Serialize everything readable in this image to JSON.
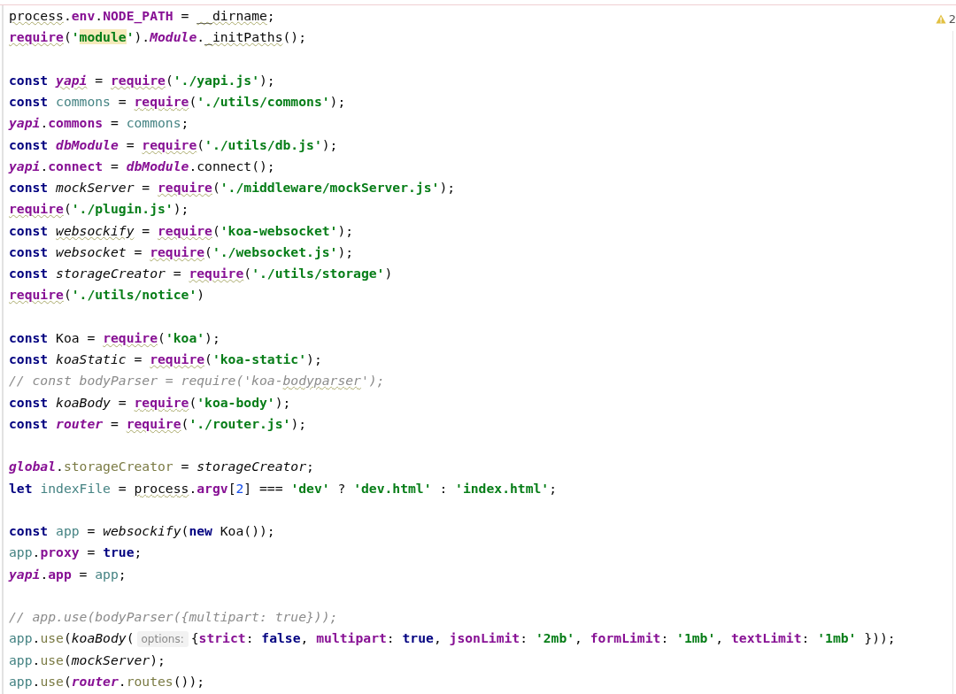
{
  "editor": {
    "warnings": "2",
    "blocks": [
      {
        "lines": [
          {
            "tokens": [
              {
                "kind": "plain",
                "text": "process",
                "squiggle": true
              },
              {
                "kind": "plain",
                "text": "."
              },
              {
                "kind": "prop",
                "text": "env"
              },
              {
                "kind": "plain",
                "text": "."
              },
              {
                "kind": "prop",
                "text": "NODE_PATH"
              },
              {
                "kind": "plain",
                "text": " = "
              },
              {
                "kind": "plain",
                "text": "__dirname",
                "squiggle": true
              },
              {
                "kind": "plain",
                "text": ";"
              }
            ]
          },
          {
            "tokens": [
              {
                "kind": "prop",
                "text": "require",
                "squiggle": true
              },
              {
                "kind": "plain",
                "text": "("
              },
              {
                "kind": "str",
                "text": "'"
              },
              {
                "kind": "str",
                "text": "module",
                "highlighted": true
              },
              {
                "kind": "str",
                "text": "'"
              },
              {
                "kind": "plain",
                "text": ")."
              },
              {
                "kind": "gvar",
                "text": "Module"
              },
              {
                "kind": "plain",
                "text": "."
              },
              {
                "kind": "plain",
                "text": "_initPaths",
                "squiggle": true
              },
              {
                "kind": "plain",
                "text": "();"
              }
            ]
          }
        ]
      },
      {
        "lines": [
          {
            "tokens": [
              {
                "kind": "kw",
                "text": "const "
              },
              {
                "kind": "gvar",
                "text": "yapi",
                "squiggle": true
              },
              {
                "kind": "plain",
                "text": " = "
              },
              {
                "kind": "prop",
                "text": "require",
                "squiggle": true
              },
              {
                "kind": "plain",
                "text": "("
              },
              {
                "kind": "str",
                "text": "'./yapi.js'"
              },
              {
                "kind": "plain",
                "text": ");"
              }
            ]
          },
          {
            "tokens": [
              {
                "kind": "kw",
                "text": "const "
              },
              {
                "kind": "lvar",
                "text": "commons"
              },
              {
                "kind": "plain",
                "text": " = "
              },
              {
                "kind": "prop",
                "text": "require",
                "squiggle": true
              },
              {
                "kind": "plain",
                "text": "("
              },
              {
                "kind": "str",
                "text": "'./utils/commons'"
              },
              {
                "kind": "plain",
                "text": ");"
              }
            ]
          },
          {
            "tokens": [
              {
                "kind": "gvar",
                "text": "yapi"
              },
              {
                "kind": "plain",
                "text": "."
              },
              {
                "kind": "prop",
                "text": "commons"
              },
              {
                "kind": "plain",
                "text": " = "
              },
              {
                "kind": "lvar",
                "text": "commons"
              },
              {
                "kind": "plain",
                "text": ";"
              }
            ]
          },
          {
            "tokens": [
              {
                "kind": "kw",
                "text": "const "
              },
              {
                "kind": "gvar",
                "text": "dbModule"
              },
              {
                "kind": "plain",
                "text": " = "
              },
              {
                "kind": "prop",
                "text": "require",
                "squiggle": true
              },
              {
                "kind": "plain",
                "text": "("
              },
              {
                "kind": "str",
                "text": "'./utils/db.js'"
              },
              {
                "kind": "plain",
                "text": ");"
              }
            ]
          },
          {
            "tokens": [
              {
                "kind": "gvar",
                "text": "yapi"
              },
              {
                "kind": "plain",
                "text": "."
              },
              {
                "kind": "prop",
                "text": "connect"
              },
              {
                "kind": "plain",
                "text": " = "
              },
              {
                "kind": "gvar",
                "text": "dbModule"
              },
              {
                "kind": "plain",
                "text": ".connect();"
              }
            ]
          },
          {
            "tokens": [
              {
                "kind": "kw",
                "text": "const "
              },
              {
                "kind": "fn",
                "text": "mockServer"
              },
              {
                "kind": "plain",
                "text": " = "
              },
              {
                "kind": "prop",
                "text": "require",
                "squiggle": true
              },
              {
                "kind": "plain",
                "text": "("
              },
              {
                "kind": "str",
                "text": "'./middleware/mockServer.js'"
              },
              {
                "kind": "plain",
                "text": ");"
              }
            ]
          },
          {
            "tokens": [
              {
                "kind": "prop",
                "text": "require",
                "squiggle": true
              },
              {
                "kind": "plain",
                "text": "("
              },
              {
                "kind": "str",
                "text": "'./plugin.js'"
              },
              {
                "kind": "plain",
                "text": ");"
              }
            ]
          },
          {
            "tokens": [
              {
                "kind": "kw",
                "text": "const "
              },
              {
                "kind": "fn",
                "text": "websockify",
                "squiggle": true
              },
              {
                "kind": "plain",
                "text": " = "
              },
              {
                "kind": "prop",
                "text": "require",
                "squiggle": true
              },
              {
                "kind": "plain",
                "text": "("
              },
              {
                "kind": "str",
                "text": "'koa-websocket'"
              },
              {
                "kind": "plain",
                "text": ");"
              }
            ]
          },
          {
            "tokens": [
              {
                "kind": "kw",
                "text": "const "
              },
              {
                "kind": "fn",
                "text": "websocket"
              },
              {
                "kind": "plain",
                "text": " = "
              },
              {
                "kind": "prop",
                "text": "require",
                "squiggle": true
              },
              {
                "kind": "plain",
                "text": "("
              },
              {
                "kind": "str",
                "text": "'./websocket.js'"
              },
              {
                "kind": "plain",
                "text": ");"
              }
            ]
          },
          {
            "tokens": [
              {
                "kind": "kw",
                "text": "const "
              },
              {
                "kind": "fn",
                "text": "storageCreator"
              },
              {
                "kind": "plain",
                "text": " = "
              },
              {
                "kind": "prop",
                "text": "require",
                "squiggle": true
              },
              {
                "kind": "plain",
                "text": "("
              },
              {
                "kind": "str",
                "text": "'./utils/storage'"
              },
              {
                "kind": "plain",
                "text": ")"
              }
            ]
          },
          {
            "tokens": [
              {
                "kind": "prop",
                "text": "require",
                "squiggle": true
              },
              {
                "kind": "plain",
                "text": "("
              },
              {
                "kind": "str",
                "text": "'./utils/notice'"
              },
              {
                "kind": "plain",
                "text": ")"
              }
            ]
          }
        ]
      },
      {
        "lines": [
          {
            "tokens": [
              {
                "kind": "kw",
                "text": "const "
              },
              {
                "kind": "plain",
                "text": "Koa = "
              },
              {
                "kind": "prop",
                "text": "require",
                "squiggle": true
              },
              {
                "kind": "plain",
                "text": "("
              },
              {
                "kind": "str",
                "text": "'koa'"
              },
              {
                "kind": "plain",
                "text": ");"
              }
            ]
          },
          {
            "tokens": [
              {
                "kind": "kw",
                "text": "const "
              },
              {
                "kind": "fn",
                "text": "koaStatic"
              },
              {
                "kind": "plain",
                "text": " = "
              },
              {
                "kind": "prop",
                "text": "require",
                "squiggle": true
              },
              {
                "kind": "plain",
                "text": "("
              },
              {
                "kind": "str",
                "text": "'koa-static'"
              },
              {
                "kind": "plain",
                "text": ");"
              }
            ]
          },
          {
            "tokens": [
              {
                "kind": "comment",
                "text": "// const bodyParser = require('koa-"
              },
              {
                "kind": "comment",
                "text": "bodyparser",
                "squiggle": true
              },
              {
                "kind": "comment",
                "text": "');"
              }
            ]
          },
          {
            "tokens": [
              {
                "kind": "kw",
                "text": "const "
              },
              {
                "kind": "fn",
                "text": "koaBody"
              },
              {
                "kind": "plain",
                "text": " = "
              },
              {
                "kind": "prop",
                "text": "require",
                "squiggle": true
              },
              {
                "kind": "plain",
                "text": "("
              },
              {
                "kind": "str",
                "text": "'koa-body'"
              },
              {
                "kind": "plain",
                "text": ");"
              }
            ]
          },
          {
            "tokens": [
              {
                "kind": "kw",
                "text": "const "
              },
              {
                "kind": "gvar",
                "text": "router"
              },
              {
                "kind": "plain",
                "text": " = "
              },
              {
                "kind": "prop",
                "text": "require",
                "squiggle": true
              },
              {
                "kind": "plain",
                "text": "("
              },
              {
                "kind": "str",
                "text": "'./router.js'"
              },
              {
                "kind": "plain",
                "text": ");"
              }
            ]
          }
        ]
      },
      {
        "lines": [
          {
            "tokens": [
              {
                "kind": "gvar",
                "text": "global"
              },
              {
                "kind": "plain",
                "text": "."
              },
              {
                "kind": "member",
                "text": "storageCreator"
              },
              {
                "kind": "plain",
                "text": " = "
              },
              {
                "kind": "fn",
                "text": "storageCreator"
              },
              {
                "kind": "plain",
                "text": ";"
              }
            ]
          },
          {
            "tokens": [
              {
                "kind": "kw",
                "text": "let "
              },
              {
                "kind": "lvar",
                "text": "indexFile"
              },
              {
                "kind": "plain",
                "text": " = "
              },
              {
                "kind": "plain",
                "text": "process",
                "squiggle": true
              },
              {
                "kind": "plain",
                "text": "."
              },
              {
                "kind": "prop",
                "text": "argv"
              },
              {
                "kind": "plain",
                "text": "["
              },
              {
                "kind": "num",
                "text": "2"
              },
              {
                "kind": "plain",
                "text": "] === "
              },
              {
                "kind": "str",
                "text": "'dev'"
              },
              {
                "kind": "plain",
                "text": " ? "
              },
              {
                "kind": "str",
                "text": "'dev.html'"
              },
              {
                "kind": "plain",
                "text": " : "
              },
              {
                "kind": "str",
                "text": "'index.html'"
              },
              {
                "kind": "plain",
                "text": ";"
              }
            ]
          }
        ]
      },
      {
        "lines": [
          {
            "tokens": [
              {
                "kind": "kw",
                "text": "const "
              },
              {
                "kind": "lvar",
                "text": "app"
              },
              {
                "kind": "plain",
                "text": " = "
              },
              {
                "kind": "fn",
                "text": "websockify"
              },
              {
                "kind": "plain",
                "text": "("
              },
              {
                "kind": "kw",
                "text": "new"
              },
              {
                "kind": "plain",
                "text": " Koa());"
              }
            ]
          },
          {
            "tokens": [
              {
                "kind": "lvar",
                "text": "app"
              },
              {
                "kind": "plain",
                "text": "."
              },
              {
                "kind": "prop",
                "text": "proxy"
              },
              {
                "kind": "plain",
                "text": " = "
              },
              {
                "kind": "kw",
                "text": "true"
              },
              {
                "kind": "plain",
                "text": ";"
              }
            ]
          },
          {
            "tokens": [
              {
                "kind": "gvar",
                "text": "yapi"
              },
              {
                "kind": "plain",
                "text": "."
              },
              {
                "kind": "prop",
                "text": "app"
              },
              {
                "kind": "plain",
                "text": " = "
              },
              {
                "kind": "lvar",
                "text": "app"
              },
              {
                "kind": "plain",
                "text": ";"
              }
            ]
          }
        ]
      },
      {
        "lines": [
          {
            "tokens": [
              {
                "kind": "comment",
                "text": "// app.use(bodyParser({multipart: true}));"
              }
            ]
          },
          {
            "tokens": [
              {
                "kind": "lvar",
                "text": "app"
              },
              {
                "kind": "plain",
                "text": "."
              },
              {
                "kind": "member",
                "text": "use"
              },
              {
                "kind": "plain",
                "text": "("
              },
              {
                "kind": "fn",
                "text": "koaBody"
              },
              {
                "kind": "plain",
                "text": "("
              },
              {
                "kind": "hint",
                "text": "options:"
              },
              {
                "kind": "plain",
                "text": "{"
              },
              {
                "kind": "prop",
                "text": "strict"
              },
              {
                "kind": "plain",
                "text": ": "
              },
              {
                "kind": "kw",
                "text": "false"
              },
              {
                "kind": "plain",
                "text": ", "
              },
              {
                "kind": "prop",
                "text": "multipart"
              },
              {
                "kind": "plain",
                "text": ": "
              },
              {
                "kind": "kw",
                "text": "true"
              },
              {
                "kind": "plain",
                "text": ", "
              },
              {
                "kind": "prop",
                "text": "jsonLimit"
              },
              {
                "kind": "plain",
                "text": ": "
              },
              {
                "kind": "str",
                "text": "'2mb'"
              },
              {
                "kind": "plain",
                "text": ", "
              },
              {
                "kind": "prop",
                "text": "formLimit"
              },
              {
                "kind": "plain",
                "text": ": "
              },
              {
                "kind": "str",
                "text": "'1mb'"
              },
              {
                "kind": "plain",
                "text": ", "
              },
              {
                "kind": "prop",
                "text": "textLimit"
              },
              {
                "kind": "plain",
                "text": ": "
              },
              {
                "kind": "str",
                "text": "'1mb'"
              },
              {
                "kind": "plain",
                "text": " }));"
              }
            ]
          },
          {
            "tokens": [
              {
                "kind": "lvar",
                "text": "app"
              },
              {
                "kind": "plain",
                "text": "."
              },
              {
                "kind": "member",
                "text": "use"
              },
              {
                "kind": "plain",
                "text": "("
              },
              {
                "kind": "fn",
                "text": "mockServer"
              },
              {
                "kind": "plain",
                "text": ");"
              }
            ]
          },
          {
            "tokens": [
              {
                "kind": "lvar",
                "text": "app"
              },
              {
                "kind": "plain",
                "text": "."
              },
              {
                "kind": "member",
                "text": "use"
              },
              {
                "kind": "plain",
                "text": "("
              },
              {
                "kind": "gvar",
                "text": "router"
              },
              {
                "kind": "plain",
                "text": "."
              },
              {
                "kind": "member",
                "text": "routes"
              },
              {
                "kind": "plain",
                "text": "());"
              }
            ]
          }
        ]
      }
    ]
  }
}
